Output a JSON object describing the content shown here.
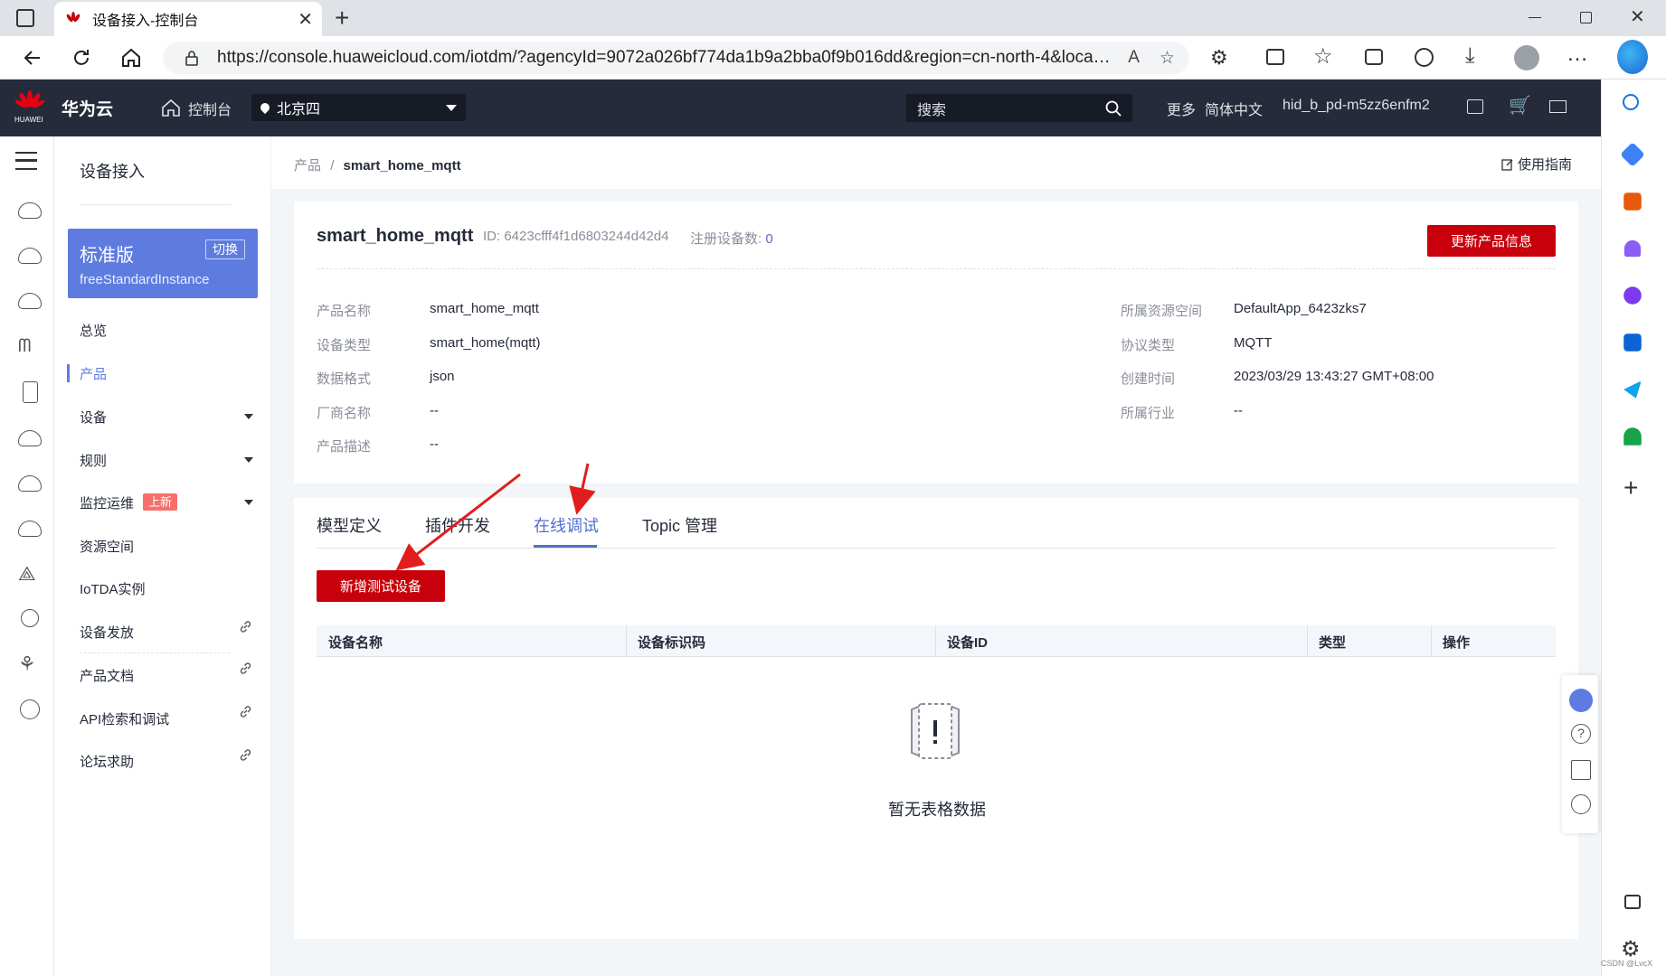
{
  "browser": {
    "tab_title": "设备接入-控制台",
    "url": "https://console.huaweicloud.com/iotdm/?agencyId=9072a026bf774da1b9a2bba0f9b016dd&region=cn-north-4&locale=zh-..."
  },
  "topnav": {
    "brand": "华为云",
    "brand_sub": "HUAWEI",
    "console": "控制台",
    "region": "北京四",
    "search_placeholder": "搜索",
    "more": "更多",
    "language": "简体中文",
    "user": "hid_b_pd-m5zz6enfm2"
  },
  "sidebar": {
    "title": "设备接入",
    "edition": "标准版",
    "switch": "切换",
    "instance": "freeStandardInstance",
    "items": [
      {
        "label": "总览"
      },
      {
        "label": "产品"
      },
      {
        "label": "设备"
      },
      {
        "label": "规则"
      },
      {
        "label": "监控运维"
      },
      {
        "label": "资源空间"
      },
      {
        "label": "IoTDA实例"
      },
      {
        "label": "设备发放"
      },
      {
        "label": "产品文档"
      },
      {
        "label": "API检索和调试"
      },
      {
        "label": "论坛求助"
      }
    ],
    "badge_new": "上新"
  },
  "breadcrumb": {
    "parent": "产品",
    "sep": "/",
    "current": "smart_home_mqtt"
  },
  "guide": "使用指南",
  "product": {
    "name": "smart_home_mqtt",
    "id_text": "ID: 6423cfff4f1d6803244d42d4",
    "reg_label": "注册设备数:",
    "reg_count": "0",
    "update_button": "更新产品信息",
    "fields_left": [
      {
        "label": "产品名称",
        "value": "smart_home_mqtt"
      },
      {
        "label": "设备类型",
        "value": "smart_home(mqtt)"
      },
      {
        "label": "数据格式",
        "value": "json"
      },
      {
        "label": "厂商名称",
        "value": "--"
      },
      {
        "label": "产品描述",
        "value": "--"
      }
    ],
    "fields_right": [
      {
        "label": "所属资源空间",
        "value": "DefaultApp_6423zks7"
      },
      {
        "label": "协议类型",
        "value": "MQTT"
      },
      {
        "label": "创建时间",
        "value": "2023/03/29 13:43:27 GMT+08:00"
      },
      {
        "label": "所属行业",
        "value": "--"
      }
    ]
  },
  "tabs": [
    "模型定义",
    "插件开发",
    "在线调试",
    "Topic 管理"
  ],
  "active_tab": "在线调试",
  "add_device_button": "新增测试设备",
  "table": {
    "columns": [
      "设备名称",
      "设备标识码",
      "设备ID",
      "类型",
      "操作"
    ],
    "empty_text": "暂无表格数据"
  },
  "watermark": "CSDN @LvcX",
  "colors": {
    "brand_red": "#c7000b",
    "accent_blue": "#526ecc",
    "edition_blue": "#5e7ce0",
    "topnav_bg": "#252b3a"
  }
}
